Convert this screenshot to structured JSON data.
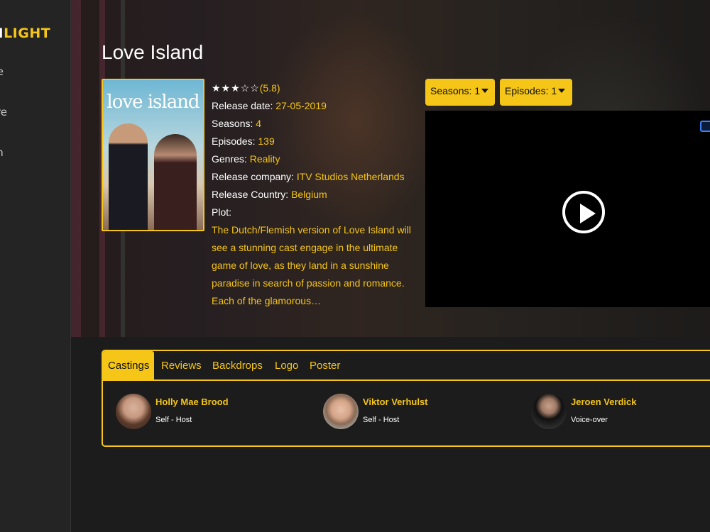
{
  "sidebar": {
    "logo_white": "ON",
    "logo_yellow": "LIGHT",
    "items": [
      {
        "label": "ome"
      },
      {
        "label": "plore"
      },
      {
        "label": "arch"
      }
    ]
  },
  "show": {
    "title": "Love Island",
    "poster_text": "love island",
    "stars": "★★★☆☆",
    "rating": "(5.8)",
    "release_date_label": "Release date: ",
    "release_date": "27-05-2019",
    "seasons_label": "Seasons: ",
    "seasons": "4",
    "episodes_label": "Episodes: ",
    "episodes": "139",
    "genres_label": "Genres: ",
    "genres": "Reality",
    "company_label": "Release company: ",
    "company": "ITV Studios Netherlands",
    "country_label": "Release Country: ",
    "country": "Belgium",
    "plot_label": "Plot:",
    "plot": "The Dutch/Flemish version of Love Island will see a stunning cast engage in the ultimate game of love, as they land in a sunshine paradise in search of passion and romance. Each of the glamorous…"
  },
  "controls": {
    "seasons_dropdown": "Seasons: 1",
    "episodes_dropdown": "Episodes: 1"
  },
  "tabs": [
    {
      "label": "Castings",
      "active": true
    },
    {
      "label": "Reviews"
    },
    {
      "label": "Backdrops"
    },
    {
      "label": "Logo"
    },
    {
      "label": "Poster"
    }
  ],
  "cast": [
    {
      "name": "Holly Mae Brood",
      "role": "Self - Host"
    },
    {
      "name": "Viktor Verhulst",
      "role": "Self - Host"
    },
    {
      "name": "Jeroen Verdick",
      "role": "Voice-over"
    }
  ],
  "colors": {
    "accent": "#f5c518",
    "background": "#1c1c1c",
    "sidebar": "#242424",
    "player": "#000000"
  }
}
